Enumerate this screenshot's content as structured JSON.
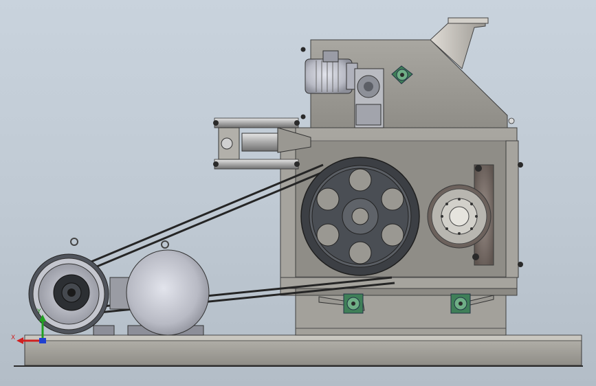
{
  "viewport": {
    "title": ""
  },
  "axis_triad": {
    "x_label": "X",
    "y_label": "Y",
    "x_color": "#d02020",
    "y_color": "#20a020",
    "z_color": "#2040d0"
  },
  "colors": {
    "background_top": "#c9d3dd",
    "background_bottom": "#b3bdc7",
    "steel": "#9a9892",
    "steel_dark": "#6d6b66",
    "pulley": "#3e4146",
    "belt": "#2b2b2b",
    "motor_body": "#c8cad2",
    "bearing_green": "#2f8a5a",
    "wear_plate": "#7b6e68"
  }
}
